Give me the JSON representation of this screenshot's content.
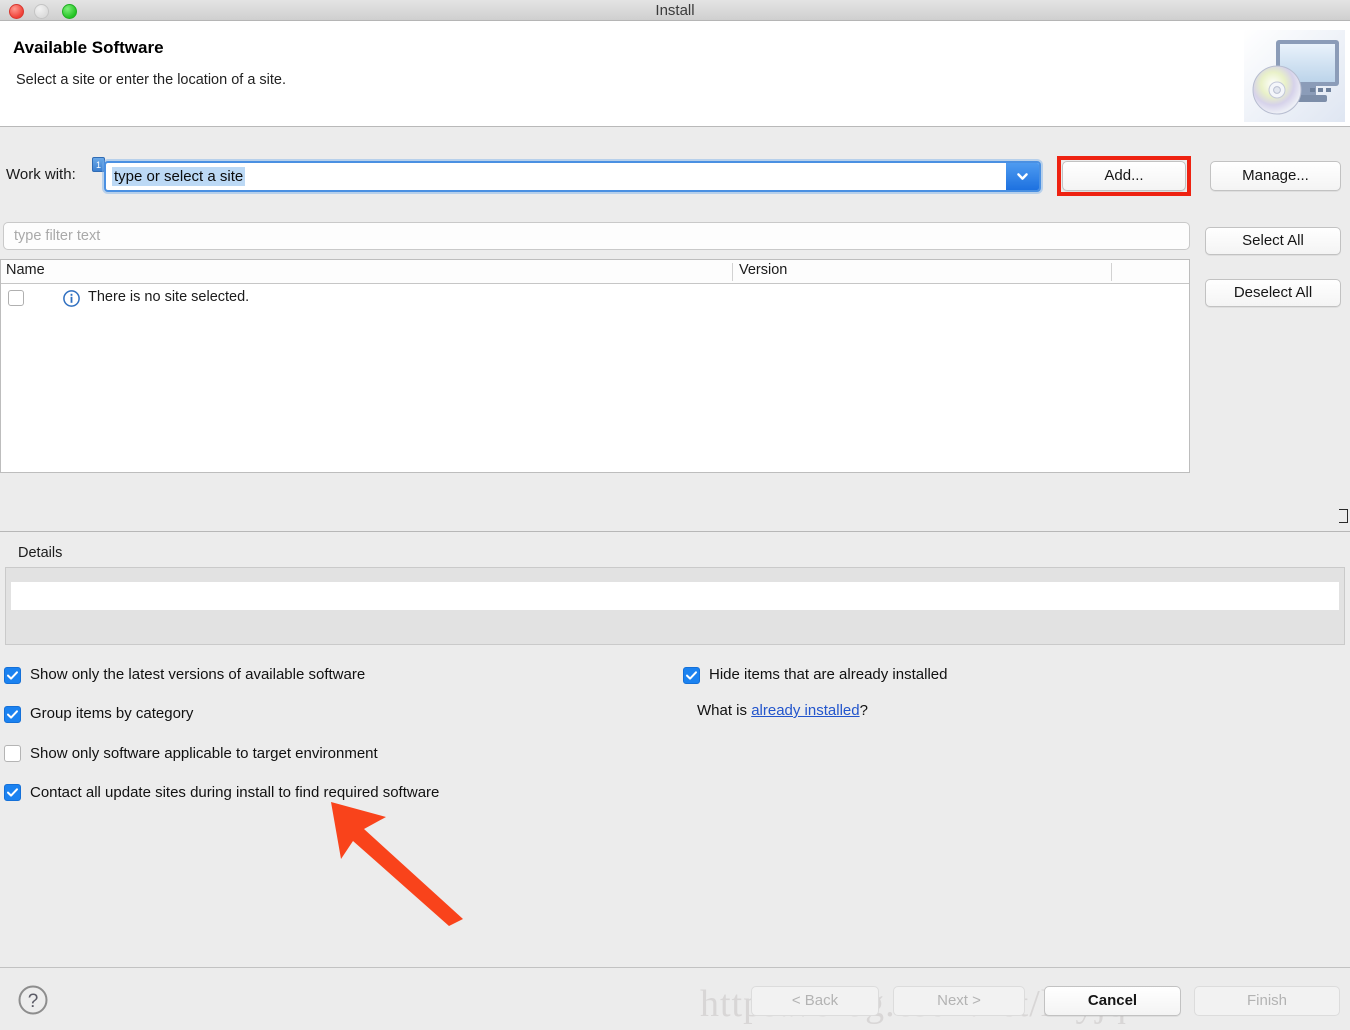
{
  "window": {
    "title": "Install",
    "traffic_lights": [
      "close-button",
      "minimize-button",
      "maximize-button"
    ]
  },
  "header": {
    "title": "Available Software",
    "subtitle": "Select a site or enter the location of a site.",
    "icon": "install-monitor-disc-icon"
  },
  "work_with": {
    "label": "Work with:",
    "assist_badge": "1",
    "value": "type or select a site",
    "placeholder": "type or select a site",
    "dropdown_icon": "chevron-down-icon",
    "add_label": "Add...",
    "manage_label": "Manage...",
    "highlight_color": "#ee2211"
  },
  "filter": {
    "placeholder": "type filter text",
    "value": ""
  },
  "table": {
    "columns": [
      "Name",
      "Version"
    ],
    "rows": [
      {
        "checked": false,
        "icon": "info-icon",
        "name": "There is no site selected.",
        "version": ""
      }
    ]
  },
  "side_buttons": {
    "select_all": "Select All",
    "deselect_all": "Deselect All"
  },
  "details": {
    "label": "Details",
    "value": ""
  },
  "options": {
    "left": [
      {
        "label": "Show only the latest versions of available software",
        "checked": true
      },
      {
        "label": "Group items by category",
        "checked": true
      },
      {
        "label": "Show only software applicable to target environment",
        "checked": false
      },
      {
        "label": "Contact all update sites during install to find required software",
        "checked": true
      }
    ],
    "right": [
      {
        "label": "Hide items that are already installed",
        "checked": true
      }
    ],
    "what_is_prefix": "What is ",
    "what_is_link": "already installed",
    "what_is_suffix": "?"
  },
  "footer": {
    "help": "?",
    "back": "< Back",
    "next": "Next >",
    "cancel": "Cancel",
    "finish": "Finish"
  },
  "annotations": {
    "arrow_color": "#f9431b",
    "arrow_target": "Contact all update sites during install to find required software"
  },
  "watermark": "https://blog.csdn.net/lilyjqx"
}
